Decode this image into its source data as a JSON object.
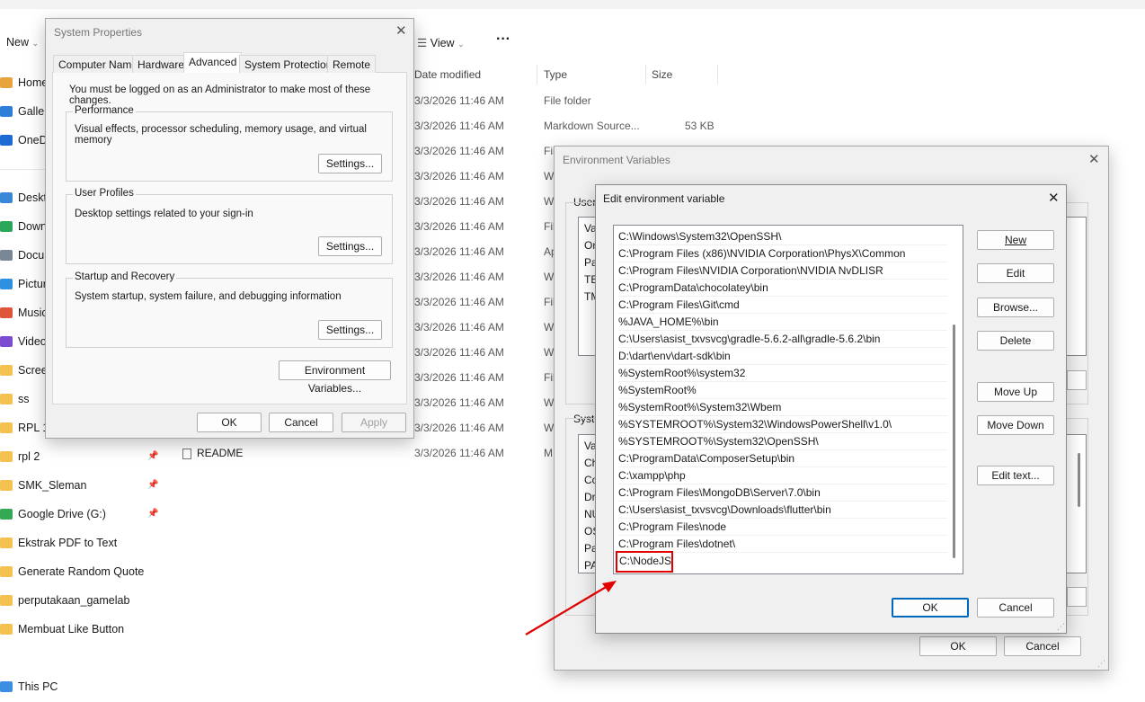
{
  "explorer": {
    "toolbar": {
      "new_label": "New",
      "view_label": "View",
      "more_label": "···"
    },
    "sidebar": [
      {
        "label": "Home",
        "icon": "home-icon"
      },
      {
        "label": "Galler",
        "icon": "gallery-icon"
      },
      {
        "label": "OneD",
        "icon": "onedrive-icon"
      },
      {
        "label": "Deskt",
        "icon": "desktop-icon"
      },
      {
        "label": "Down",
        "icon": "download-icon"
      },
      {
        "label": "Docu",
        "icon": "documents-icon"
      },
      {
        "label": "Pictur",
        "icon": "pictures-icon"
      },
      {
        "label": "Music",
        "icon": "music-icon"
      },
      {
        "label": "Video",
        "icon": "videos-icon"
      },
      {
        "label": "Screer",
        "icon": "folder-icon"
      },
      {
        "label": "ss",
        "icon": "folder-icon"
      },
      {
        "label": "RPL 1",
        "icon": "folder-icon"
      },
      {
        "label": "rpl 2",
        "icon": "folder-icon",
        "pinned": true
      },
      {
        "label": "SMK_Sleman",
        "icon": "folder-icon",
        "pinned": true
      },
      {
        "label": "Google Drive (G:)",
        "icon": "drive-icon",
        "pinned": true
      },
      {
        "label": "Ekstrak PDF to Text",
        "icon": "folder-icon"
      },
      {
        "label": "Generate Random Quote",
        "icon": "folder-icon"
      },
      {
        "label": "perputakaan_gamelab",
        "icon": "folder-icon"
      },
      {
        "label": "Membuat Like Button",
        "icon": "folder-icon"
      },
      {
        "label": "This PC",
        "icon": "pc-icon"
      }
    ],
    "columns": {
      "date": "Date modified",
      "type": "Type",
      "size": "Size"
    },
    "rows": [
      {
        "date": "3/3/2026 11:46 AM",
        "type": "File folder",
        "size": ""
      },
      {
        "date": "3/3/2026 11:46 AM",
        "type": "Markdown Source...",
        "size": "53 KB"
      },
      {
        "date": "3/3/2026 11:46 AM",
        "type": "Fil",
        "size": ""
      },
      {
        "date": "3/3/2026 11:46 AM",
        "type": "W",
        "size": ""
      },
      {
        "date": "3/3/2026 11:46 AM",
        "type": "W",
        "size": ""
      },
      {
        "date": "3/3/2026 11:46 AM",
        "type": "Fil",
        "size": ""
      },
      {
        "date": "3/3/2026 11:46 AM",
        "type": "Ap",
        "size": ""
      },
      {
        "date": "3/3/2026 11:46 AM",
        "type": "W",
        "size": ""
      },
      {
        "date": "3/3/2026 11:46 AM",
        "type": "Fil",
        "size": ""
      },
      {
        "date": "3/3/2026 11:46 AM",
        "type": "W",
        "size": ""
      },
      {
        "date": "3/3/2026 11:46 AM",
        "type": "W",
        "size": ""
      },
      {
        "date": "3/3/2026 11:46 AM",
        "type": "Fil",
        "size": ""
      },
      {
        "date": "3/3/2026 11:46 AM",
        "type": "W",
        "size": ""
      },
      {
        "date": "3/3/2026 11:46 AM",
        "type": "W",
        "size": ""
      },
      {
        "date": "3/3/2026 11:46 AM",
        "type": "M",
        "size": ""
      }
    ],
    "readme_label": "README"
  },
  "sysprops": {
    "title": "System Properties",
    "tabs": [
      "Computer Name",
      "Hardware",
      "Advanced",
      "System Protection",
      "Remote"
    ],
    "admin_note": "You must be logged on as an Administrator to make most of these changes.",
    "performance": {
      "title": "Performance",
      "desc": "Visual effects, processor scheduling, memory usage, and virtual memory",
      "button": "Settings..."
    },
    "profiles": {
      "title": "User Profiles",
      "desc": "Desktop settings related to your sign-in",
      "button": "Settings..."
    },
    "startup": {
      "title": "Startup and Recovery",
      "desc": "System startup, system failure, and debugging information",
      "button": "Settings..."
    },
    "env_button": "Environment Variables...",
    "ok": "OK",
    "cancel": "Cancel",
    "apply": "Apply"
  },
  "envvars": {
    "title": "Environment Variables",
    "user_group": "User",
    "user_peek": [
      "Va",
      "On",
      "Pa",
      "TE",
      "TM"
    ],
    "system_group": "Syste",
    "system_peek": [
      "Va",
      "Ch",
      "Co",
      "Dr",
      "NU",
      "OS",
      "Pa",
      "PA"
    ],
    "ok": "OK",
    "cancel": "Cancel"
  },
  "editvar": {
    "title": "Edit environment variable",
    "entries": [
      "C:\\Windows\\System32\\OpenSSH\\",
      "C:\\Program Files (x86)\\NVIDIA Corporation\\PhysX\\Common",
      "C:\\Program Files\\NVIDIA Corporation\\NVIDIA NvDLISR",
      "C:\\ProgramData\\chocolatey\\bin",
      "C:\\Program Files\\Git\\cmd",
      "%JAVA_HOME%\\bin",
      "C:\\Users\\asist_txvsvcg\\gradle-5.6.2-all\\gradle-5.6.2\\bin",
      "D:\\dart\\env\\dart-sdk\\bin",
      "%SystemRoot%\\system32",
      "%SystemRoot%",
      "%SystemRoot%\\System32\\Wbem",
      "%SYSTEMROOT%\\System32\\WindowsPowerShell\\v1.0\\",
      "%SYSTEMROOT%\\System32\\OpenSSH\\",
      "C:\\ProgramData\\ComposerSetup\\bin",
      "C:\\xampp\\php",
      "C:\\Program Files\\MongoDB\\Server\\7.0\\bin",
      "C:\\Users\\asist_txvsvcg\\Downloads\\flutter\\bin",
      "C:\\Program Files\\node",
      "C:\\Program Files\\dotnet\\",
      "C:\\NodeJS"
    ],
    "buttons": {
      "new": "New",
      "edit": "Edit",
      "browse": "Browse...",
      "delete": "Delete",
      "move_up": "Move Up",
      "move_down": "Move Down",
      "edit_text": "Edit text..."
    },
    "ok": "OK",
    "cancel": "Cancel",
    "highlight_color": "#e00000"
  }
}
